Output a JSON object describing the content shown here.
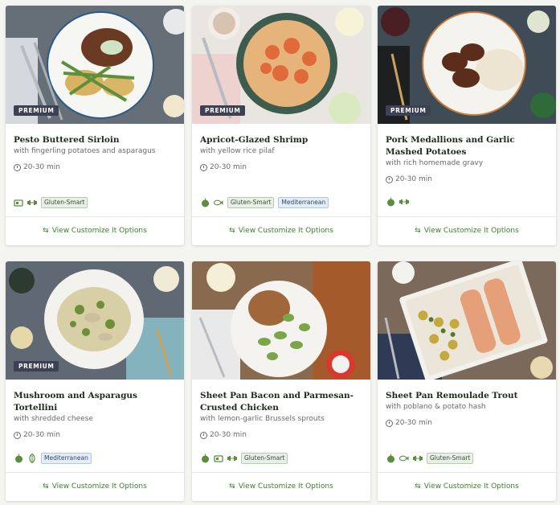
{
  "cards": [
    {
      "title": "Pesto Buttered Sirloin",
      "subtitle": "with fingerling potatoes and asparagus",
      "time": "20-30 min",
      "badge": "PREMIUM",
      "icons": [
        "tray-icon",
        "dumbbell-icon"
      ],
      "tags": [
        {
          "label": "Gluten-Smart",
          "kind": "green"
        }
      ],
      "customize": "View Customize It Options"
    },
    {
      "title": "Apricot-Glazed Shrimp",
      "subtitle": "with yellow rice pilaf",
      "time": "20-30 min",
      "badge": "PREMIUM",
      "icons": [
        "apple-icon",
        "fish-icon"
      ],
      "tags": [
        {
          "label": "Gluten-Smart",
          "kind": "green"
        },
        {
          "label": "Mediterranean",
          "kind": "blue"
        }
      ],
      "customize": "View Customize It Options"
    },
    {
      "title": "Pork Medallions and Garlic Mashed Potatoes",
      "subtitle": "with rich homemade gravy",
      "time": "20-30 min",
      "badge": "PREMIUM",
      "icons": [
        "apple-icon",
        "dumbbell-icon"
      ],
      "tags": [],
      "customize": "View Customize It Options"
    },
    {
      "title": "Mushroom and Asparagus Tortellini",
      "subtitle": "with shredded cheese",
      "time": "20-30 min",
      "badge": "PREMIUM",
      "icons": [
        "apple-icon",
        "leaf-icon"
      ],
      "tags": [
        {
          "label": "Mediterranean",
          "kind": "blue"
        }
      ],
      "customize": "View Customize It Options"
    },
    {
      "title": "Sheet Pan Bacon and Parmesan-Crusted Chicken",
      "subtitle": "with lemon-garlic Brussels sprouts",
      "time": "20-30 min",
      "badge": "",
      "icons": [
        "apple-icon",
        "tray-icon",
        "dumbbell-icon"
      ],
      "tags": [
        {
          "label": "Gluten-Smart",
          "kind": "green"
        }
      ],
      "customize": "View Customize It Options"
    },
    {
      "title": "Sheet Pan Remoulade Trout",
      "subtitle": "with poblano & potato hash",
      "time": "20-30 min",
      "badge": "",
      "icons": [
        "apple-icon",
        "fish-icon",
        "dumbbell-icon"
      ],
      "tags": [
        {
          "label": "Gluten-Smart",
          "kind": "green"
        }
      ],
      "customize": "View Customize It Options"
    }
  ],
  "colors": {
    "badge_bg": "#3c4155",
    "link_green": "#3f7f2e",
    "icon_green": "#5a8f3e"
  }
}
